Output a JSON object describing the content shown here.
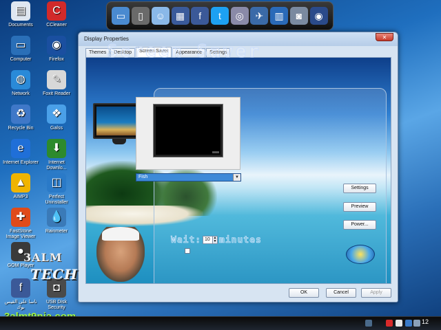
{
  "desktop": {
    "icons": [
      {
        "label": "Documents",
        "icon": "folder-documents-icon",
        "color": "#dfe7f1"
      },
      {
        "label": "Computer",
        "icon": "computer-icon",
        "color": "#2a6fb8"
      },
      {
        "label": "Network",
        "icon": "network-globe-icon",
        "color": "#2a8ad8"
      },
      {
        "label": "Recycle Bin",
        "icon": "recycle-bin-icon",
        "color": "#3f78c8"
      },
      {
        "label": "Internet Explorer",
        "icon": "internet-explorer-icon",
        "color": "#1f6fd8"
      },
      {
        "label": "AIMP3",
        "icon": "aimp3-icon",
        "color": "#f0b400"
      },
      {
        "label": "FastStone Image Viewer",
        "icon": "faststone-icon",
        "color": "#e04b1a"
      },
      {
        "label": "GOM Player",
        "icon": "gom-player-icon",
        "color": "#3a3a3a"
      },
      {
        "label": "ناسا على القيس بوك",
        "icon": "facebook-app-icon",
        "color": "#3b5998"
      },
      {
        "label": "CCleaner",
        "icon": "ccleaner-icon",
        "color": "#d12a2a"
      },
      {
        "label": "Firefox",
        "icon": "firefox-icon",
        "color": "#1a4fa0"
      },
      {
        "label": "Foxit Reader",
        "icon": "foxit-reader-icon",
        "color": "#d8d8d8"
      },
      {
        "label": "Galss",
        "icon": "galss-icon",
        "color": "#4aa0e8"
      },
      {
        "label": "Internet Downlo...",
        "icon": "internet-download-icon",
        "color": "#2d8a2d"
      },
      {
        "label": "Perfect Uninstaller",
        "icon": "perfect-uninstaller-icon",
        "color": "#2a7ac8"
      },
      {
        "label": "Rainmeter",
        "icon": "rainmeter-icon",
        "color": "#3a7ab8"
      },
      {
        "label": "USB Disk Security",
        "icon": "usb-disk-security-icon",
        "color": "#4a4a4a"
      }
    ]
  },
  "dock": {
    "icons": [
      {
        "name": "monitor-icon",
        "color": "#4a8ad0"
      },
      {
        "name": "door-icon",
        "color": "#6a6a6a"
      },
      {
        "name": "finder-icon",
        "color": "#8ab8e8"
      },
      {
        "name": "calculator-icon",
        "color": "#3a5a9a"
      },
      {
        "name": "facebook-icon",
        "color": "#3b5998"
      },
      {
        "name": "twitter-icon",
        "color": "#1da1f2"
      },
      {
        "name": "disk-utility-icon",
        "color": "#8a8aa8"
      },
      {
        "name": "satellite-icon",
        "color": "#3a6aa8"
      },
      {
        "name": "equalizer-icon",
        "color": "#2a6ab8"
      },
      {
        "name": "camera-icon",
        "color": "#7a8aa0"
      },
      {
        "name": "dvd-icon",
        "color": "#2a4a8a"
      }
    ]
  },
  "window": {
    "title": "Display Properties",
    "close_label": "✕",
    "tabs": [
      "Themes",
      "Desktop",
      "Screen Saver",
      "Appearance",
      "Settings"
    ],
    "active_tab": "Screen Saver",
    "screensaver": {
      "heading": "Screen Saver",
      "selected": "Fish",
      "dropdown_arrow": "▼",
      "buttons": {
        "settings": "Settings",
        "preview": "Preview",
        "power": "Power..."
      },
      "wait_label": "Wait:",
      "wait_value": "10",
      "minutes_label": "minutes"
    },
    "footer": {
      "ok": "OK",
      "cancel": "Cancel",
      "apply": "Apply"
    }
  },
  "watermark": {
    "line1": "3ALM",
    "line2": "TECH",
    "url": "3almt9nia.com"
  },
  "taskbar": {
    "clock": "12"
  }
}
